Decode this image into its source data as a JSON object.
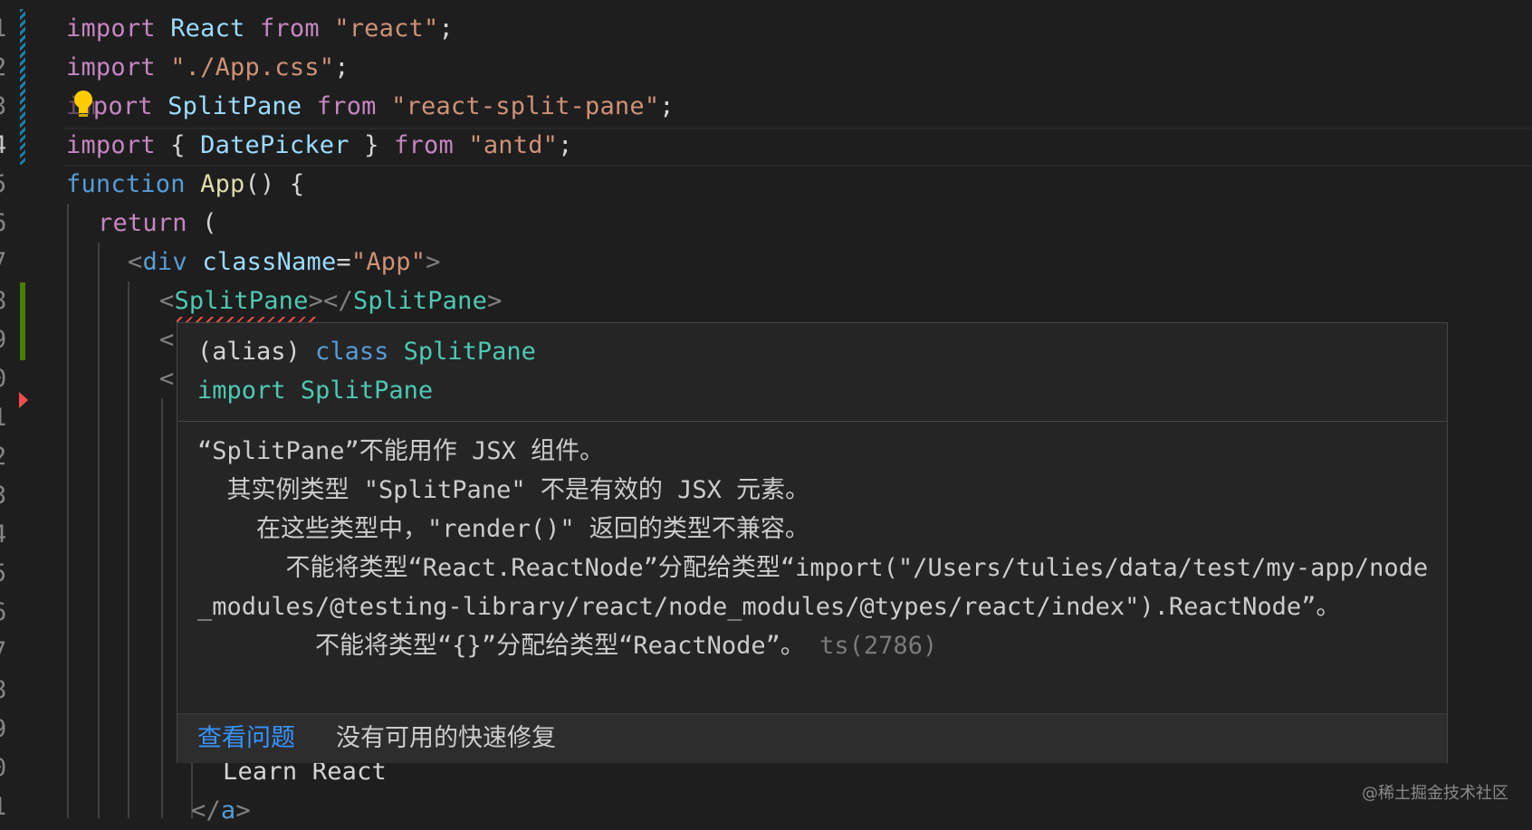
{
  "gutter": {
    "line_numbers": [
      "1",
      "2",
      "3",
      "4",
      "5",
      "6",
      "7",
      "8",
      "9",
      "0",
      "1",
      "2",
      "3",
      "4",
      "5",
      "6",
      "7",
      "8",
      "9",
      "0",
      "1"
    ]
  },
  "code": {
    "line1": {
      "kw1": "import",
      "id": "React",
      "kw2": "from",
      "str": "\"react\"",
      "end": ";"
    },
    "line2": {
      "kw1": "import",
      "str": "\"./App.css\"",
      "end": ";"
    },
    "line3": {
      "kw1": "port",
      "id": "SplitPane",
      "kw2": "from",
      "str": "\"react-split-pane\"",
      "end": ";"
    },
    "line4": {
      "kw1": "import",
      "open": "{ ",
      "id": "DatePicker",
      "close": " }",
      "kw2": "from",
      "str": "\"antd\"",
      "end": ";"
    },
    "line5": {
      "kw": "function",
      "fn": "App",
      "rest": "() {"
    },
    "line6": {
      "kw": "return",
      "rest": " ("
    },
    "line7": {
      "lt": "<",
      "tag": "div",
      "attr": "className",
      "eq": "=",
      "str": "\"App\"",
      "gt": ">"
    },
    "line8": {
      "lt": "<",
      "tag": "SplitPane",
      "mid": "></",
      "tag2": "SplitPane",
      "gt": ">"
    },
    "line9": {
      "lt": "<"
    },
    "line10": {
      "lt": "<"
    },
    "line20": {
      "text": "Learn React"
    },
    "line21": {
      "lt": "</",
      "tag": "a",
      "gt": ">"
    }
  },
  "hover": {
    "sig_line1_a": "(alias)",
    "sig_line1_kw": "class",
    "sig_line1_name": "SplitPane",
    "sig_line2_kw": "import",
    "sig_line2_name": "SplitPane",
    "message": {
      "l1": "“SplitPane”不能用作 JSX 组件。",
      "l2": "  其实例类型 \"SplitPane\" 不是有效的 JSX 元素。",
      "l3": "    在这些类型中，\"render()\" 返回的类型不兼容。",
      "l4": "      不能将类型“React.ReactNode”分配给类型“import(\"/Users/tulies/data/test/my-app/node_modules/@testing-library/react/node_modules/@types/react/index\").ReactNode”。",
      "l5": "        不能将类型“{}”分配给类型“ReactNode”。",
      "code": "ts(2786)"
    },
    "actions": {
      "view_problem": "查看问题",
      "no_fix": "没有可用的快速修复"
    }
  },
  "watermark": "@稀土掘金技术社区",
  "icons": {
    "lightbulb": "lightbulb-icon",
    "error_marker": "error-marker-icon"
  },
  "colors": {
    "background": "#1e1e1e",
    "link": "#3794ff",
    "error": "#f14c4c"
  }
}
